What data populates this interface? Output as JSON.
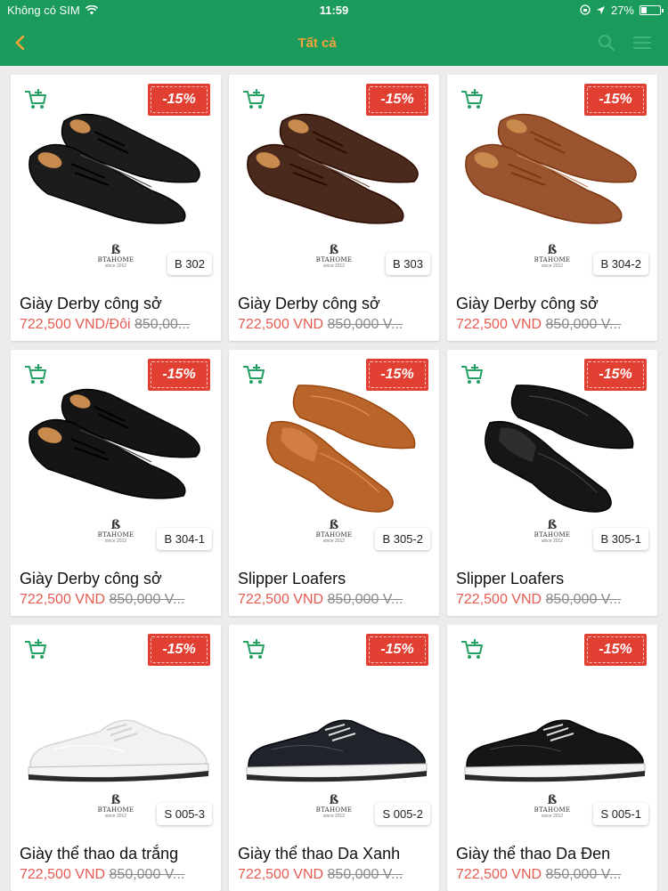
{
  "status_bar": {
    "carrier": "Không có SIM",
    "time": "11:59",
    "battery": "27%",
    "battery_level": 0.27
  },
  "nav": {
    "title": "Tất cả"
  },
  "brand": {
    "name": "BTAHOME",
    "since": "since 2012"
  },
  "colors": {
    "accent": "#1a9b5c",
    "discount": "#e23f33",
    "price": "#e55b52"
  },
  "products": [
    {
      "discount": "-15%",
      "code": "B 302",
      "name": "Giày Derby công sở",
      "price": "722,500 VND/Đôi",
      "old_price": "850,00...",
      "shoe_color": "#1c1c1c",
      "style": "derby"
    },
    {
      "discount": "-15%",
      "code": "B 303",
      "name": "Giày Derby công sở",
      "price": "722,500 VND",
      "old_price": "850,000 V...",
      "shoe_color": "#4a2a1c",
      "style": "derby"
    },
    {
      "discount": "-15%",
      "code": "B 304-2",
      "name": "Giày Derby công sở",
      "price": "722,500 VND",
      "old_price": "850,000 V...",
      "shoe_color": "#9a5530",
      "style": "derby"
    },
    {
      "discount": "-15%",
      "code": "B 304-1",
      "name": "Giày Derby công sở",
      "price": "722,500 VND",
      "old_price": "850,000 V...",
      "shoe_color": "#151515",
      "style": "derby"
    },
    {
      "discount": "-15%",
      "code": "B 305-2",
      "name": "Slipper Loafers",
      "price": "722,500 VND",
      "old_price": "850,000 V...",
      "shoe_color": "#b8642a",
      "style": "loafer"
    },
    {
      "discount": "-15%",
      "code": "B 305-1",
      "name": "Slipper Loafers",
      "price": "722,500 VND",
      "old_price": "850,000 V...",
      "shoe_color": "#161616",
      "style": "loafer"
    },
    {
      "discount": "-15%",
      "code": "S 005-3",
      "name": "Giày thể thao da trắng",
      "price": "722,500 VND",
      "old_price": "850,000 V...",
      "shoe_color": "#f2f2f2",
      "style": "sneaker"
    },
    {
      "discount": "-15%",
      "code": "S 005-2",
      "name": "Giày thể thao Da Xanh",
      "price": "722,500 VND",
      "old_price": "850,000 V...",
      "shoe_color": "#20232a",
      "style": "sneaker"
    },
    {
      "discount": "-15%",
      "code": "S 005-1",
      "name": "Giày thể thao Da Đen",
      "price": "722,500 VND",
      "old_price": "850,000 V...",
      "shoe_color": "#161616",
      "style": "sneaker"
    }
  ]
}
